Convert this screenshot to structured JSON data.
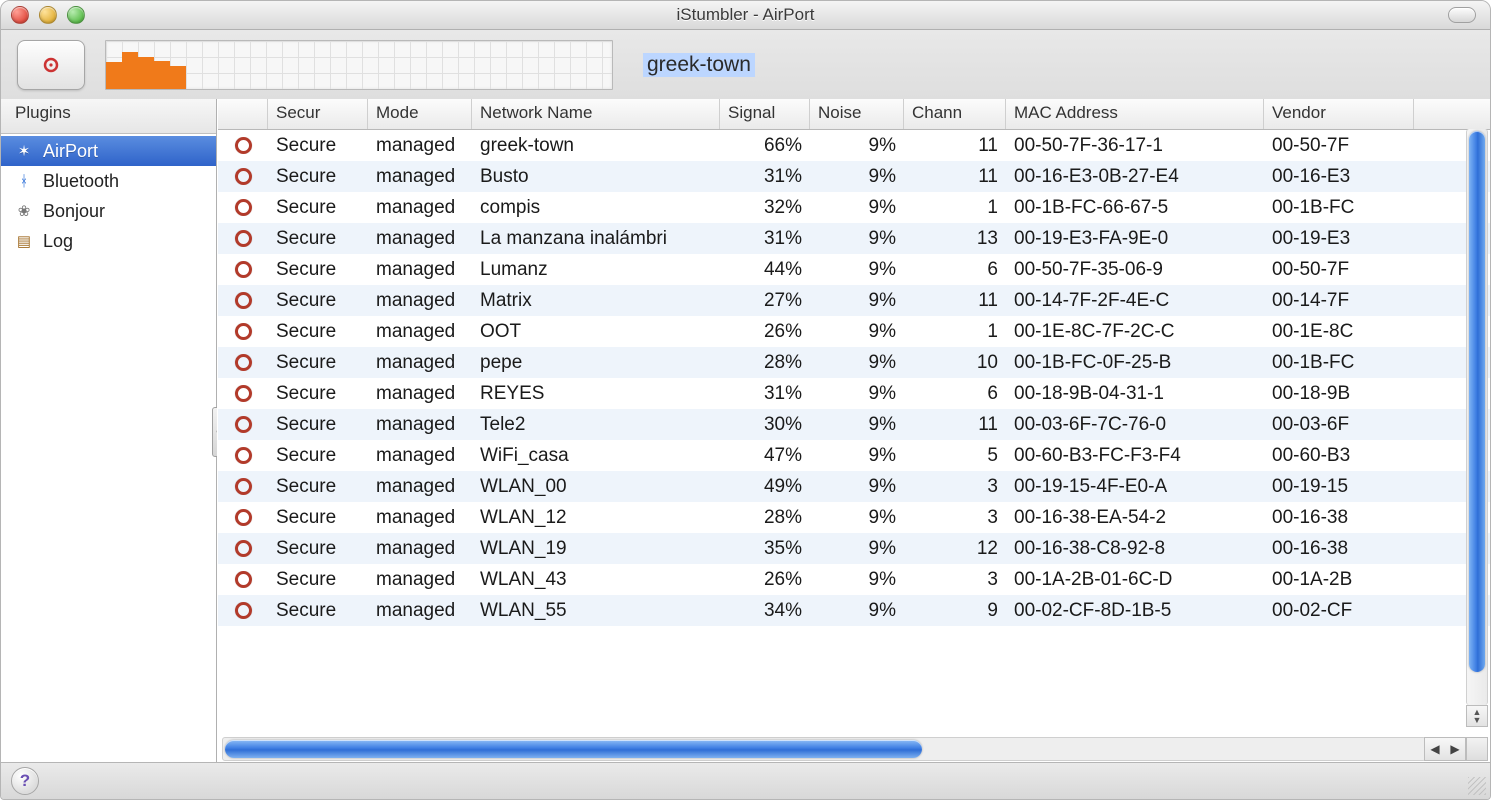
{
  "window": {
    "title": "iStumbler - AirPort"
  },
  "toolbar": {
    "selected_network": "greek-town"
  },
  "sidebar": {
    "header": "Plugins",
    "items": [
      {
        "label": "AirPort",
        "icon": "wifi-icon",
        "selected": true
      },
      {
        "label": "Bluetooth",
        "icon": "bluetooth-icon",
        "selected": false
      },
      {
        "label": "Bonjour",
        "icon": "bonjour-icon",
        "selected": false
      },
      {
        "label": "Log",
        "icon": "log-icon",
        "selected": false
      }
    ]
  },
  "columns": {
    "icon": "",
    "secur": "Secur",
    "mode": "Mode",
    "name": "Network Name",
    "signal": "Signal",
    "noise": "Noise",
    "chann": "Chann",
    "mac": "MAC Address",
    "vendor": "Vendor"
  },
  "networks": [
    {
      "secure": "Secure",
      "mode": "managed",
      "name": "greek-town",
      "signal": "66%",
      "noise": "9%",
      "chann": "11",
      "mac": "00-50-7F-36-17-1",
      "vendor": "00-50-7F"
    },
    {
      "secure": "Secure",
      "mode": "managed",
      "name": "Busto",
      "signal": "31%",
      "noise": "9%",
      "chann": "11",
      "mac": "00-16-E3-0B-27-E4",
      "vendor": "00-16-E3"
    },
    {
      "secure": "Secure",
      "mode": "managed",
      "name": "compis",
      "signal": "32%",
      "noise": "9%",
      "chann": "1",
      "mac": "00-1B-FC-66-67-5",
      "vendor": "00-1B-FC"
    },
    {
      "secure": "Secure",
      "mode": "managed",
      "name": "La manzana inalámbri",
      "signal": "31%",
      "noise": "9%",
      "chann": "13",
      "mac": "00-19-E3-FA-9E-0",
      "vendor": "00-19-E3"
    },
    {
      "secure": "Secure",
      "mode": "managed",
      "name": "Lumanz",
      "signal": "44%",
      "noise": "9%",
      "chann": "6",
      "mac": "00-50-7F-35-06-9",
      "vendor": "00-50-7F"
    },
    {
      "secure": "Secure",
      "mode": "managed",
      "name": "Matrix",
      "signal": "27%",
      "noise": "9%",
      "chann": "11",
      "mac": "00-14-7F-2F-4E-C",
      "vendor": "00-14-7F"
    },
    {
      "secure": "Secure",
      "mode": "managed",
      "name": "OOT",
      "signal": "26%",
      "noise": "9%",
      "chann": "1",
      "mac": "00-1E-8C-7F-2C-C",
      "vendor": "00-1E-8C"
    },
    {
      "secure": "Secure",
      "mode": "managed",
      "name": "pepe",
      "signal": "28%",
      "noise": "9%",
      "chann": "10",
      "mac": "00-1B-FC-0F-25-B",
      "vendor": "00-1B-FC"
    },
    {
      "secure": "Secure",
      "mode": "managed",
      "name": "REYES",
      "signal": "31%",
      "noise": "9%",
      "chann": "6",
      "mac": "00-18-9B-04-31-1",
      "vendor": "00-18-9B"
    },
    {
      "secure": "Secure",
      "mode": "managed",
      "name": "Tele2",
      "signal": "30%",
      "noise": "9%",
      "chann": "11",
      "mac": "00-03-6F-7C-76-0",
      "vendor": "00-03-6F"
    },
    {
      "secure": "Secure",
      "mode": "managed",
      "name": "WiFi_casa",
      "signal": "47%",
      "noise": "9%",
      "chann": "5",
      "mac": "00-60-B3-FC-F3-F4",
      "vendor": "00-60-B3"
    },
    {
      "secure": "Secure",
      "mode": "managed",
      "name": "WLAN_00",
      "signal": "49%",
      "noise": "9%",
      "chann": "3",
      "mac": "00-19-15-4F-E0-A",
      "vendor": "00-19-15"
    },
    {
      "secure": "Secure",
      "mode": "managed",
      "name": "WLAN_12",
      "signal": "28%",
      "noise": "9%",
      "chann": "3",
      "mac": "00-16-38-EA-54-2",
      "vendor": "00-16-38"
    },
    {
      "secure": "Secure",
      "mode": "managed",
      "name": "WLAN_19",
      "signal": "35%",
      "noise": "9%",
      "chann": "12",
      "mac": "00-16-38-C8-92-8",
      "vendor": "00-16-38"
    },
    {
      "secure": "Secure",
      "mode": "managed",
      "name": "WLAN_43",
      "signal": "26%",
      "noise": "9%",
      "chann": "3",
      "mac": "00-1A-2B-01-6C-D",
      "vendor": "00-1A-2B"
    },
    {
      "secure": "Secure",
      "mode": "managed",
      "name": "WLAN_55",
      "signal": "34%",
      "noise": "9%",
      "chann": "9",
      "mac": "00-02-CF-8D-1B-5",
      "vendor": "00-02-CF"
    }
  ],
  "graph": {
    "bars_pct": [
      58,
      80,
      70,
      60,
      50
    ]
  },
  "icons": {
    "wifi": "✶",
    "bluetooth": "ᚼ",
    "bonjour": "❀",
    "log": "▤"
  }
}
